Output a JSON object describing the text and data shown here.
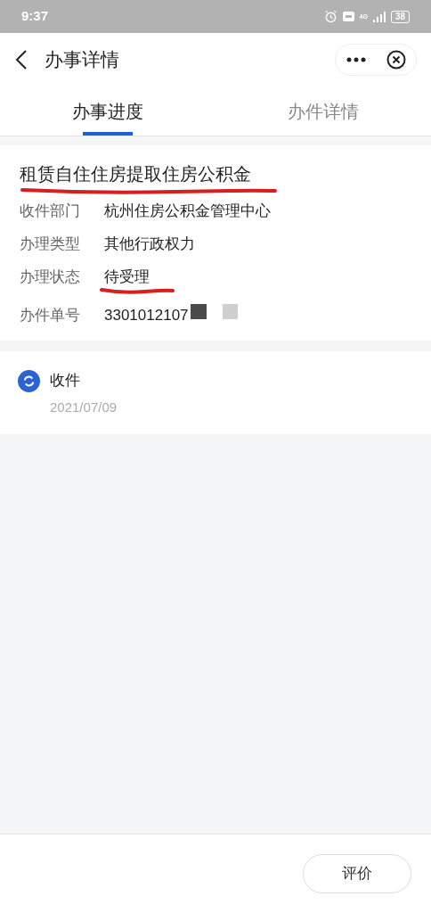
{
  "status_bar": {
    "time": "9:37",
    "network": "4G",
    "battery": "38"
  },
  "header": {
    "title": "办事详情"
  },
  "tabs": [
    {
      "label": "办事进度",
      "selected": true
    },
    {
      "label": "办件详情",
      "selected": false
    }
  ],
  "case": {
    "title": "租赁自住住房提取住房公积金",
    "title_underlined": true,
    "fields": [
      {
        "label": "收件部门",
        "value": "杭州住房公积金管理中心",
        "underlined": false,
        "redacted": false
      },
      {
        "label": "办理类型",
        "value": "其他行政权力",
        "underlined": false,
        "redacted": false
      },
      {
        "label": "办理状态",
        "value": "待受理",
        "underlined": true,
        "redacted": false
      },
      {
        "label": "办件单号",
        "value": "3301012107",
        "underlined": false,
        "redacted": true
      }
    ]
  },
  "timeline": [
    {
      "step": "收件",
      "date": "2021/07/09"
    }
  ],
  "footer": {
    "button": "评价"
  }
}
